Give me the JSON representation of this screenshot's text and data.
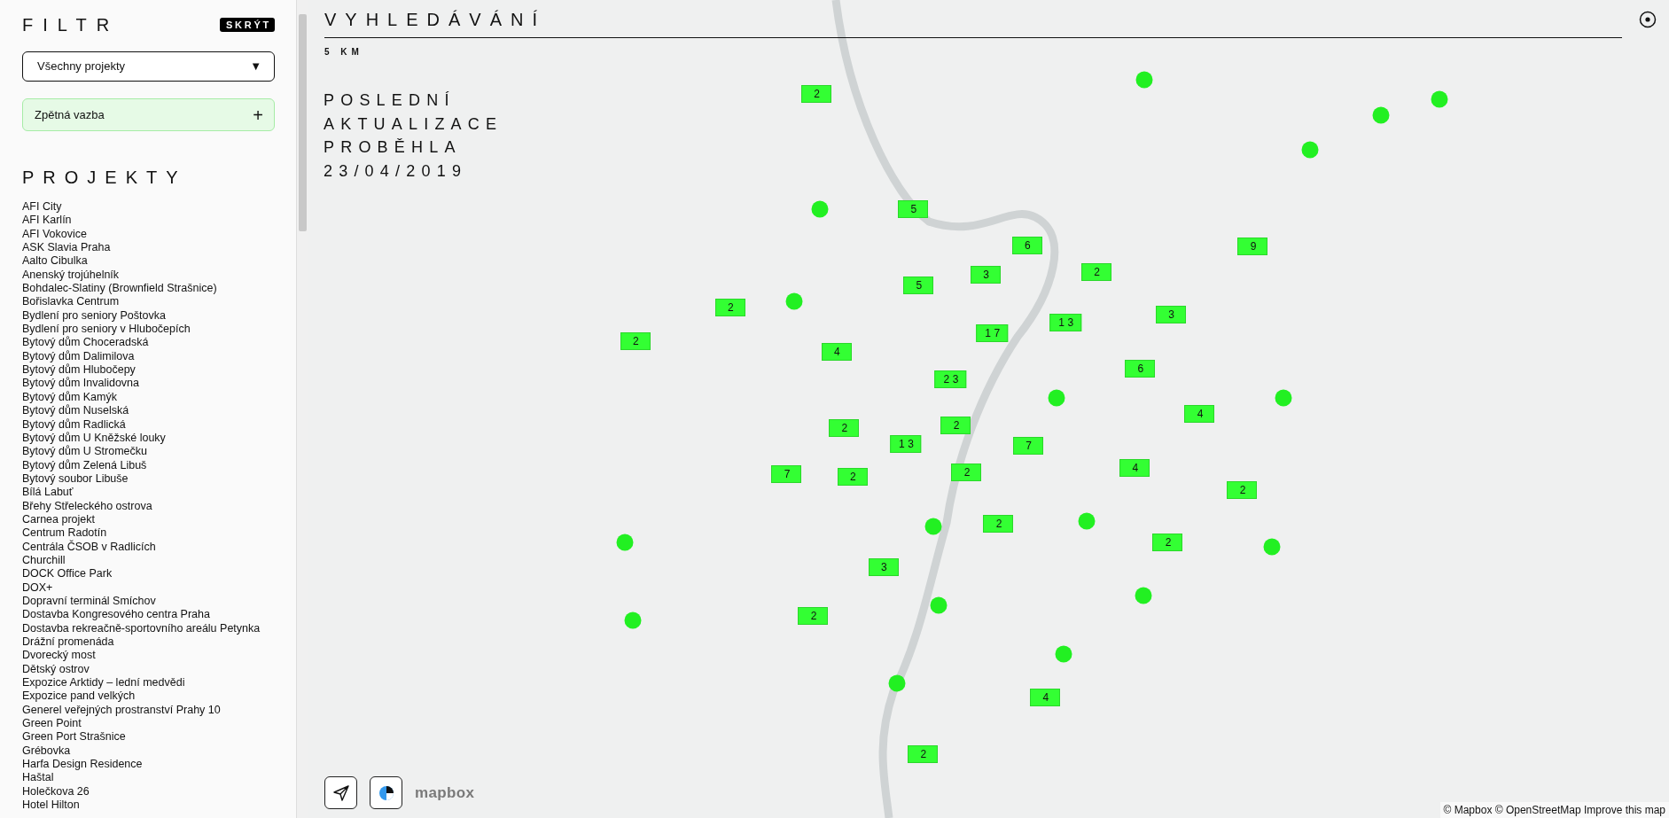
{
  "sidebar": {
    "title": "FILTR",
    "hide_button": "SKRÝT",
    "project_select": {
      "value": "Všechny projekty",
      "arrow": "▼"
    },
    "feedback": {
      "label": "Zpětná vazba",
      "icon_text": "+"
    },
    "projects_heading": "PROJEKTY",
    "projects": [
      "AFI City",
      "AFI Karlín",
      "AFI Vokovice",
      "ASK Slavia Praha",
      "Aalto Cibulka",
      "Anenský trojúhelník",
      "Bohdalec-Slatiny (Brownfield Strašnice)",
      "Bořislavka Centrum",
      "Bydlení pro seniory Poštovka",
      "Bydlení pro seniory v Hlubočepích",
      "Bytový dům Choceradská",
      "Bytový dům Dalimilova",
      "Bytový dům Hlubočepy",
      "Bytový dům Invalidovna",
      "Bytový dům Kamýk",
      "Bytový dům Nuselská",
      "Bytový dům Radlická",
      "Bytový dům U Kněžské louky",
      "Bytový dům U Stromečku",
      "Bytový dům Zelená Libuš",
      "Bytový soubor Libuše",
      "Bílá Labuť",
      "Břehy Střeleckého ostrova",
      "Carnea projekt",
      "Centrum Radotín",
      "Centrála ČSOB v Radlicích",
      "Churchill",
      "DOCK Office Park",
      "DOX+",
      "Dopravní terminál Smíchov",
      "Dostavba Kongresového centra Praha",
      "Dostavba rekreačně-sportovního areálu Petynka",
      "Drážní promenáda",
      "Dvorecký most",
      "Dětský ostrov",
      "Expozice Arktidy – lední medvědi",
      "Expozice pand velkých",
      "Generel veřejných prostranství Prahy 10",
      "Green Point",
      "Green Port Strašnice",
      "Grébovka",
      "Harfa Design Residence",
      "Haštal",
      "Holečkova 26",
      "Hotel Hilton"
    ]
  },
  "map": {
    "search_title": "VYHLEDÁVÁNÍ",
    "scale": "5 KM",
    "last_update": "POSLEDNÍ AKTUALIZACE PROBĚHLA 23/04/2019",
    "markers": [
      {
        "kind": "cluster",
        "count": "2"
      },
      {
        "kind": "point"
      },
      {
        "kind": "point"
      },
      {
        "kind": "point"
      },
      {
        "kind": "point"
      },
      {
        "kind": "cluster",
        "count": "5"
      },
      {
        "kind": "point"
      },
      {
        "kind": "cluster",
        "count": "6"
      },
      {
        "kind": "cluster",
        "count": "9"
      },
      {
        "kind": "cluster",
        "count": "2"
      },
      {
        "kind": "cluster",
        "count": "3"
      },
      {
        "kind": "cluster",
        "count": "5"
      },
      {
        "kind": "cluster",
        "count": "2"
      },
      {
        "kind": "point"
      },
      {
        "kind": "cluster",
        "count": "3"
      },
      {
        "kind": "cluster",
        "count": "13"
      },
      {
        "kind": "cluster",
        "count": "17"
      },
      {
        "kind": "cluster",
        "count": "2"
      },
      {
        "kind": "cluster",
        "count": "4"
      },
      {
        "kind": "cluster",
        "count": "6"
      },
      {
        "kind": "cluster",
        "count": "23"
      },
      {
        "kind": "point"
      },
      {
        "kind": "point"
      },
      {
        "kind": "cluster",
        "count": "4"
      },
      {
        "kind": "cluster",
        "count": "2"
      },
      {
        "kind": "cluster",
        "count": "2"
      },
      {
        "kind": "cluster",
        "count": "13"
      },
      {
        "kind": "cluster",
        "count": "7"
      },
      {
        "kind": "cluster",
        "count": "4"
      },
      {
        "kind": "cluster",
        "count": "7"
      },
      {
        "kind": "cluster",
        "count": "2"
      },
      {
        "kind": "cluster",
        "count": "2"
      },
      {
        "kind": "cluster",
        "count": "2"
      },
      {
        "kind": "point"
      },
      {
        "kind": "cluster",
        "count": "2"
      },
      {
        "kind": "point"
      },
      {
        "kind": "point"
      },
      {
        "kind": "cluster",
        "count": "2"
      },
      {
        "kind": "point"
      },
      {
        "kind": "cluster",
        "count": "3"
      },
      {
        "kind": "point"
      },
      {
        "kind": "point"
      },
      {
        "kind": "cluster",
        "count": "2"
      },
      {
        "kind": "point"
      },
      {
        "kind": "point"
      },
      {
        "kind": "point"
      },
      {
        "kind": "cluster",
        "count": "4"
      },
      {
        "kind": "cluster",
        "count": "2"
      }
    ],
    "logo": "mapbox",
    "attribution": "© Mapbox © OpenStreetMap",
    "improve_link": "Improve this map"
  }
}
